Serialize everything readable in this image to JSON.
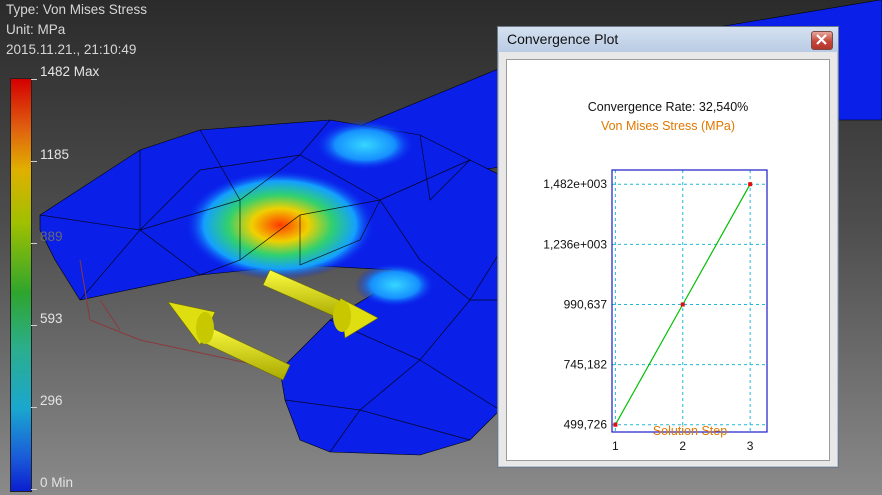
{
  "viewport_header": {
    "type_line": "Type: Von Mises Stress",
    "unit_line": "Unit: MPa",
    "date_line": "2015.11.21., 21:10:49"
  },
  "legend": {
    "labels": [
      "1482 Max",
      "1185",
      "889",
      "593",
      "296",
      "0 Min"
    ]
  },
  "dialog": {
    "title": "Convergence Plot",
    "close_label": "close-icon"
  },
  "chart_data": {
    "type": "line",
    "title": "Convergence Rate: 32,540%",
    "ylabel": "Von Mises Stress (MPa)",
    "xlabel": "Solution Step",
    "x": [
      1,
      2,
      3
    ],
    "y": [
      499.726,
      990.637,
      1482
    ],
    "x_tick_labels": [
      "1",
      "2",
      "3"
    ],
    "y_tick_labels": [
      "499,726",
      "745,182",
      "990,637",
      "1,236e+003",
      "1,482e+003"
    ],
    "y_ticks": [
      499.726,
      745.182,
      990.637,
      1236,
      1482
    ],
    "xlim": [
      0.95,
      3.25
    ],
    "ylim": [
      470,
      1540
    ],
    "grid": true,
    "colors": {
      "line": "#00c000",
      "marker": "#e01010",
      "frame": "#1a1ac8",
      "grid": "#20b8d8",
      "label": "#e07800"
    }
  }
}
